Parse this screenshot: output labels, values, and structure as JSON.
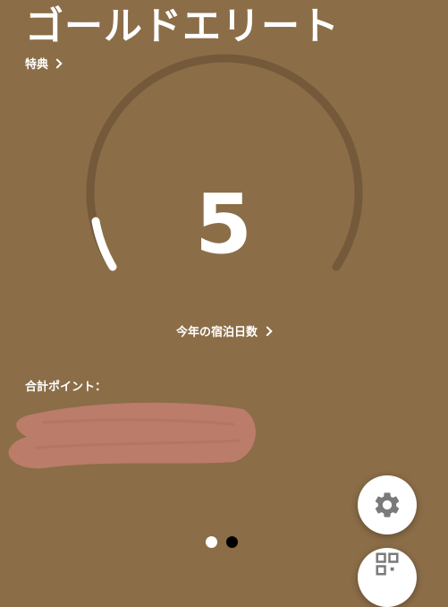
{
  "tier": {
    "title": "ゴールドエリート"
  },
  "benefits_link": {
    "label": "特典"
  },
  "gauge": {
    "nights_value": "5",
    "progress_fraction": 0.06,
    "track_color": "#74593a",
    "progress_color": "#ffffff"
  },
  "nights_link": {
    "label": "今年の宿泊日数"
  },
  "points": {
    "label": "合計ポイント："
  },
  "redaction": {
    "color": "#bb7c69"
  },
  "fabs": {
    "settings_icon": "gear-icon",
    "qr_icon": "qr-code-icon"
  },
  "pager": {
    "count": 2,
    "active_index": 0
  },
  "colors": {
    "background": "#8b6d48"
  }
}
